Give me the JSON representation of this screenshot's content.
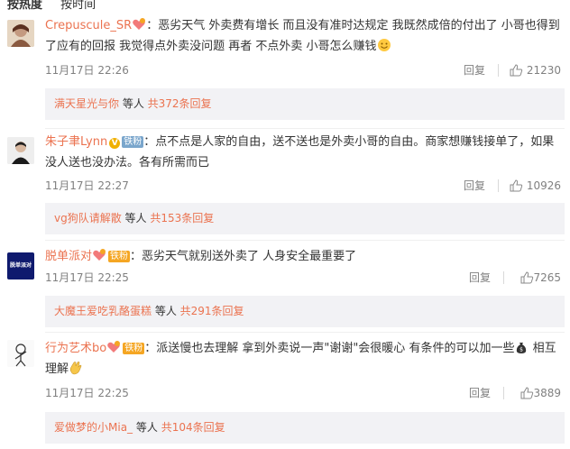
{
  "tabs": [
    "按热度",
    "按时间"
  ],
  "comments": [
    {
      "user": "Crepuscule_SR",
      "badge": "",
      "text": "：恶劣天气 外卖费有增长 而且没有准时达规定 我既然成倍的付出了 小哥也得到了应有的回报 我觉得点外卖没问题 再者 不点外卖 小哥怎么赚钱",
      "time": "11月17日 22:26",
      "reply_label": "回复",
      "likes": "21230",
      "sub_user": "满天星光与你",
      "sub_mid": " 等人 ",
      "sub_count": "共372条回复"
    },
    {
      "user": "朱子聿Lynn",
      "badge": "铁粉",
      "text": "：点不点是人家的自由，送不送也是外卖小哥的自由。商家想赚钱接单了，如果没人送也没办法。各有所需而已",
      "time": "11月17日 22:27",
      "reply_label": "回复",
      "likes": "10926",
      "sub_user": "vg狗队请解散",
      "sub_mid": " 等人 ",
      "sub_count": "共153条回复"
    },
    {
      "user": "脱单派对",
      "badge": "铁粉",
      "text": "：恶劣天气就别送外卖了 人身安全最重要了",
      "time": "11月17日 22:25",
      "reply_label": "回复",
      "likes": "7265",
      "sub_user": "大魔王爱吃乳酪蛋糕",
      "sub_mid": " 等人 ",
      "sub_count": "共291条回复"
    },
    {
      "user": "行为艺术bo",
      "badge": "铁粉",
      "text": "：派送慢也去理解 拿到外卖说一声\"谢谢\"会很暖心 有条件的可以加一些",
      "text2": " 相互理解",
      "time": "11月17日 22:25",
      "reply_label": "回复",
      "likes": "3889",
      "sub_user": "爱做梦的小Mia_",
      "sub_mid": " 等人 ",
      "sub_count": "共104条回复"
    }
  ],
  "avatar3_text": "脱单派对",
  "colors": {
    "link": "#eb7350",
    "meta": "#808080",
    "subbg": "#f2f2f5"
  }
}
